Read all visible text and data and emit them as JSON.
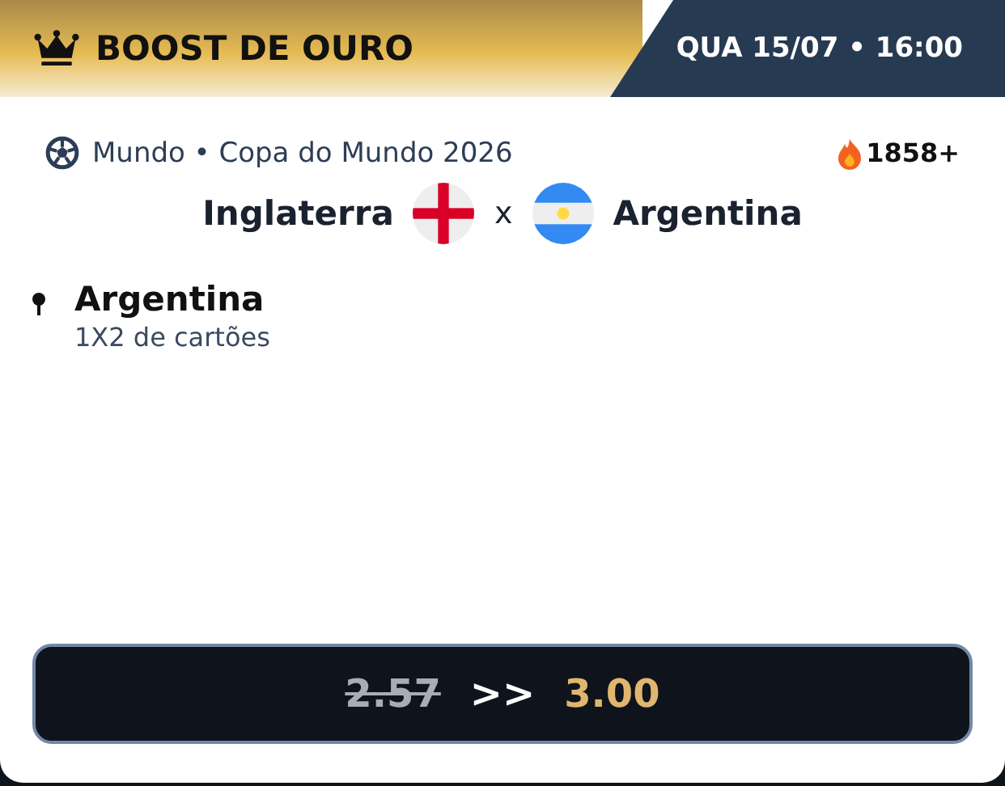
{
  "header": {
    "title": "BOOST DE OURO",
    "datetime": "QUA 15/07 • 16:00"
  },
  "competition": "Mundo • Copa do Mundo 2026",
  "popularity": "1858+",
  "match": {
    "home": "Inglaterra",
    "separator": "x",
    "away": "Argentina"
  },
  "selection": {
    "name": "Argentina",
    "market": "1X2 de cartões"
  },
  "odds": {
    "old": "2.57",
    "arrow": ">>",
    "new": "3.00"
  }
}
